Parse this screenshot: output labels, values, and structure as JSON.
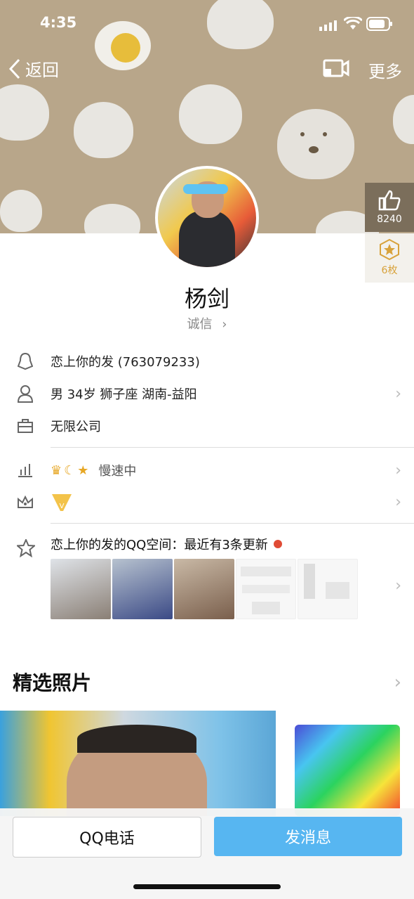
{
  "status": {
    "time": "4:35"
  },
  "nav": {
    "back_label": "返回",
    "more_label": "更多"
  },
  "stats": {
    "likes": "8240",
    "stars_label": "6枚"
  },
  "profile": {
    "name": "杨剑",
    "credit_label": "诚信"
  },
  "info": {
    "qq_line": "恋上你的发 (763079233)",
    "person_line": "男  34岁  狮子座  湖南-益阳",
    "company_line": "无限公司",
    "level_text": "慢速中",
    "qzone_line": "恋上你的发的QQ空间：最近有3条更新"
  },
  "photos": {
    "section_title": "精选照片"
  },
  "actions": {
    "call_label": "QQ电话",
    "message_label": "发消息"
  },
  "colors": {
    "header": "#b8a68a",
    "accent": "#57b6f1",
    "badge_red": "#e04b35"
  }
}
